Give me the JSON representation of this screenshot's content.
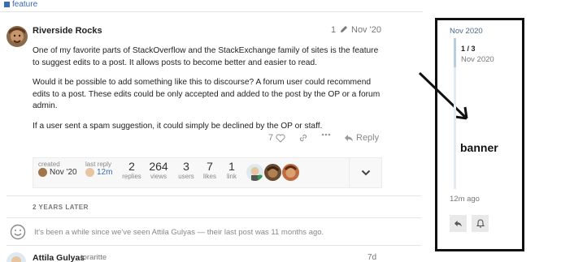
{
  "category": {
    "label": "feature",
    "color": "#3a6bb5"
  },
  "post": {
    "author": "Riverside Rocks",
    "edit_count": "1",
    "date": "Nov '20",
    "paragraphs": [
      "One of my favorite parts of StackOverflow and the StackExchange family of sites is the feature to suggest edits to a post. It allows posts to become better and easier to read.",
      "Would it be possible to add something like this to discourse? A forum user could recommend edits to a post. These edits could be only accepted and added to the post by the OP or a forum admin.",
      "If a user sent a spam suggestion, it could simply be declined by the OP or staff."
    ],
    "like_count": "7",
    "reply_label": "Reply"
  },
  "summary": {
    "created_label": "created",
    "created_value": "Nov '20",
    "last_reply_label": "last reply",
    "last_reply_value": "12m",
    "stats": [
      {
        "num": "2",
        "label": "replies"
      },
      {
        "num": "264",
        "label": "views"
      },
      {
        "num": "3",
        "label": "users"
      },
      {
        "num": "7",
        "label": "likes"
      },
      {
        "num": "1",
        "label": "link"
      }
    ]
  },
  "gap": {
    "label": "2 YEARS LATER"
  },
  "small_action": {
    "text": "It's been a while since we've seen Attila Gulyas — their last post was 11 months ago."
  },
  "reply": {
    "author": "Attila Gulyas",
    "handle": "toraritte",
    "date": "7d"
  },
  "timeline": {
    "top_date": "Nov 2020",
    "position": "1 / 3",
    "position_date": "Nov 2020",
    "annotation": "banner",
    "bottom": "12m ago"
  }
}
